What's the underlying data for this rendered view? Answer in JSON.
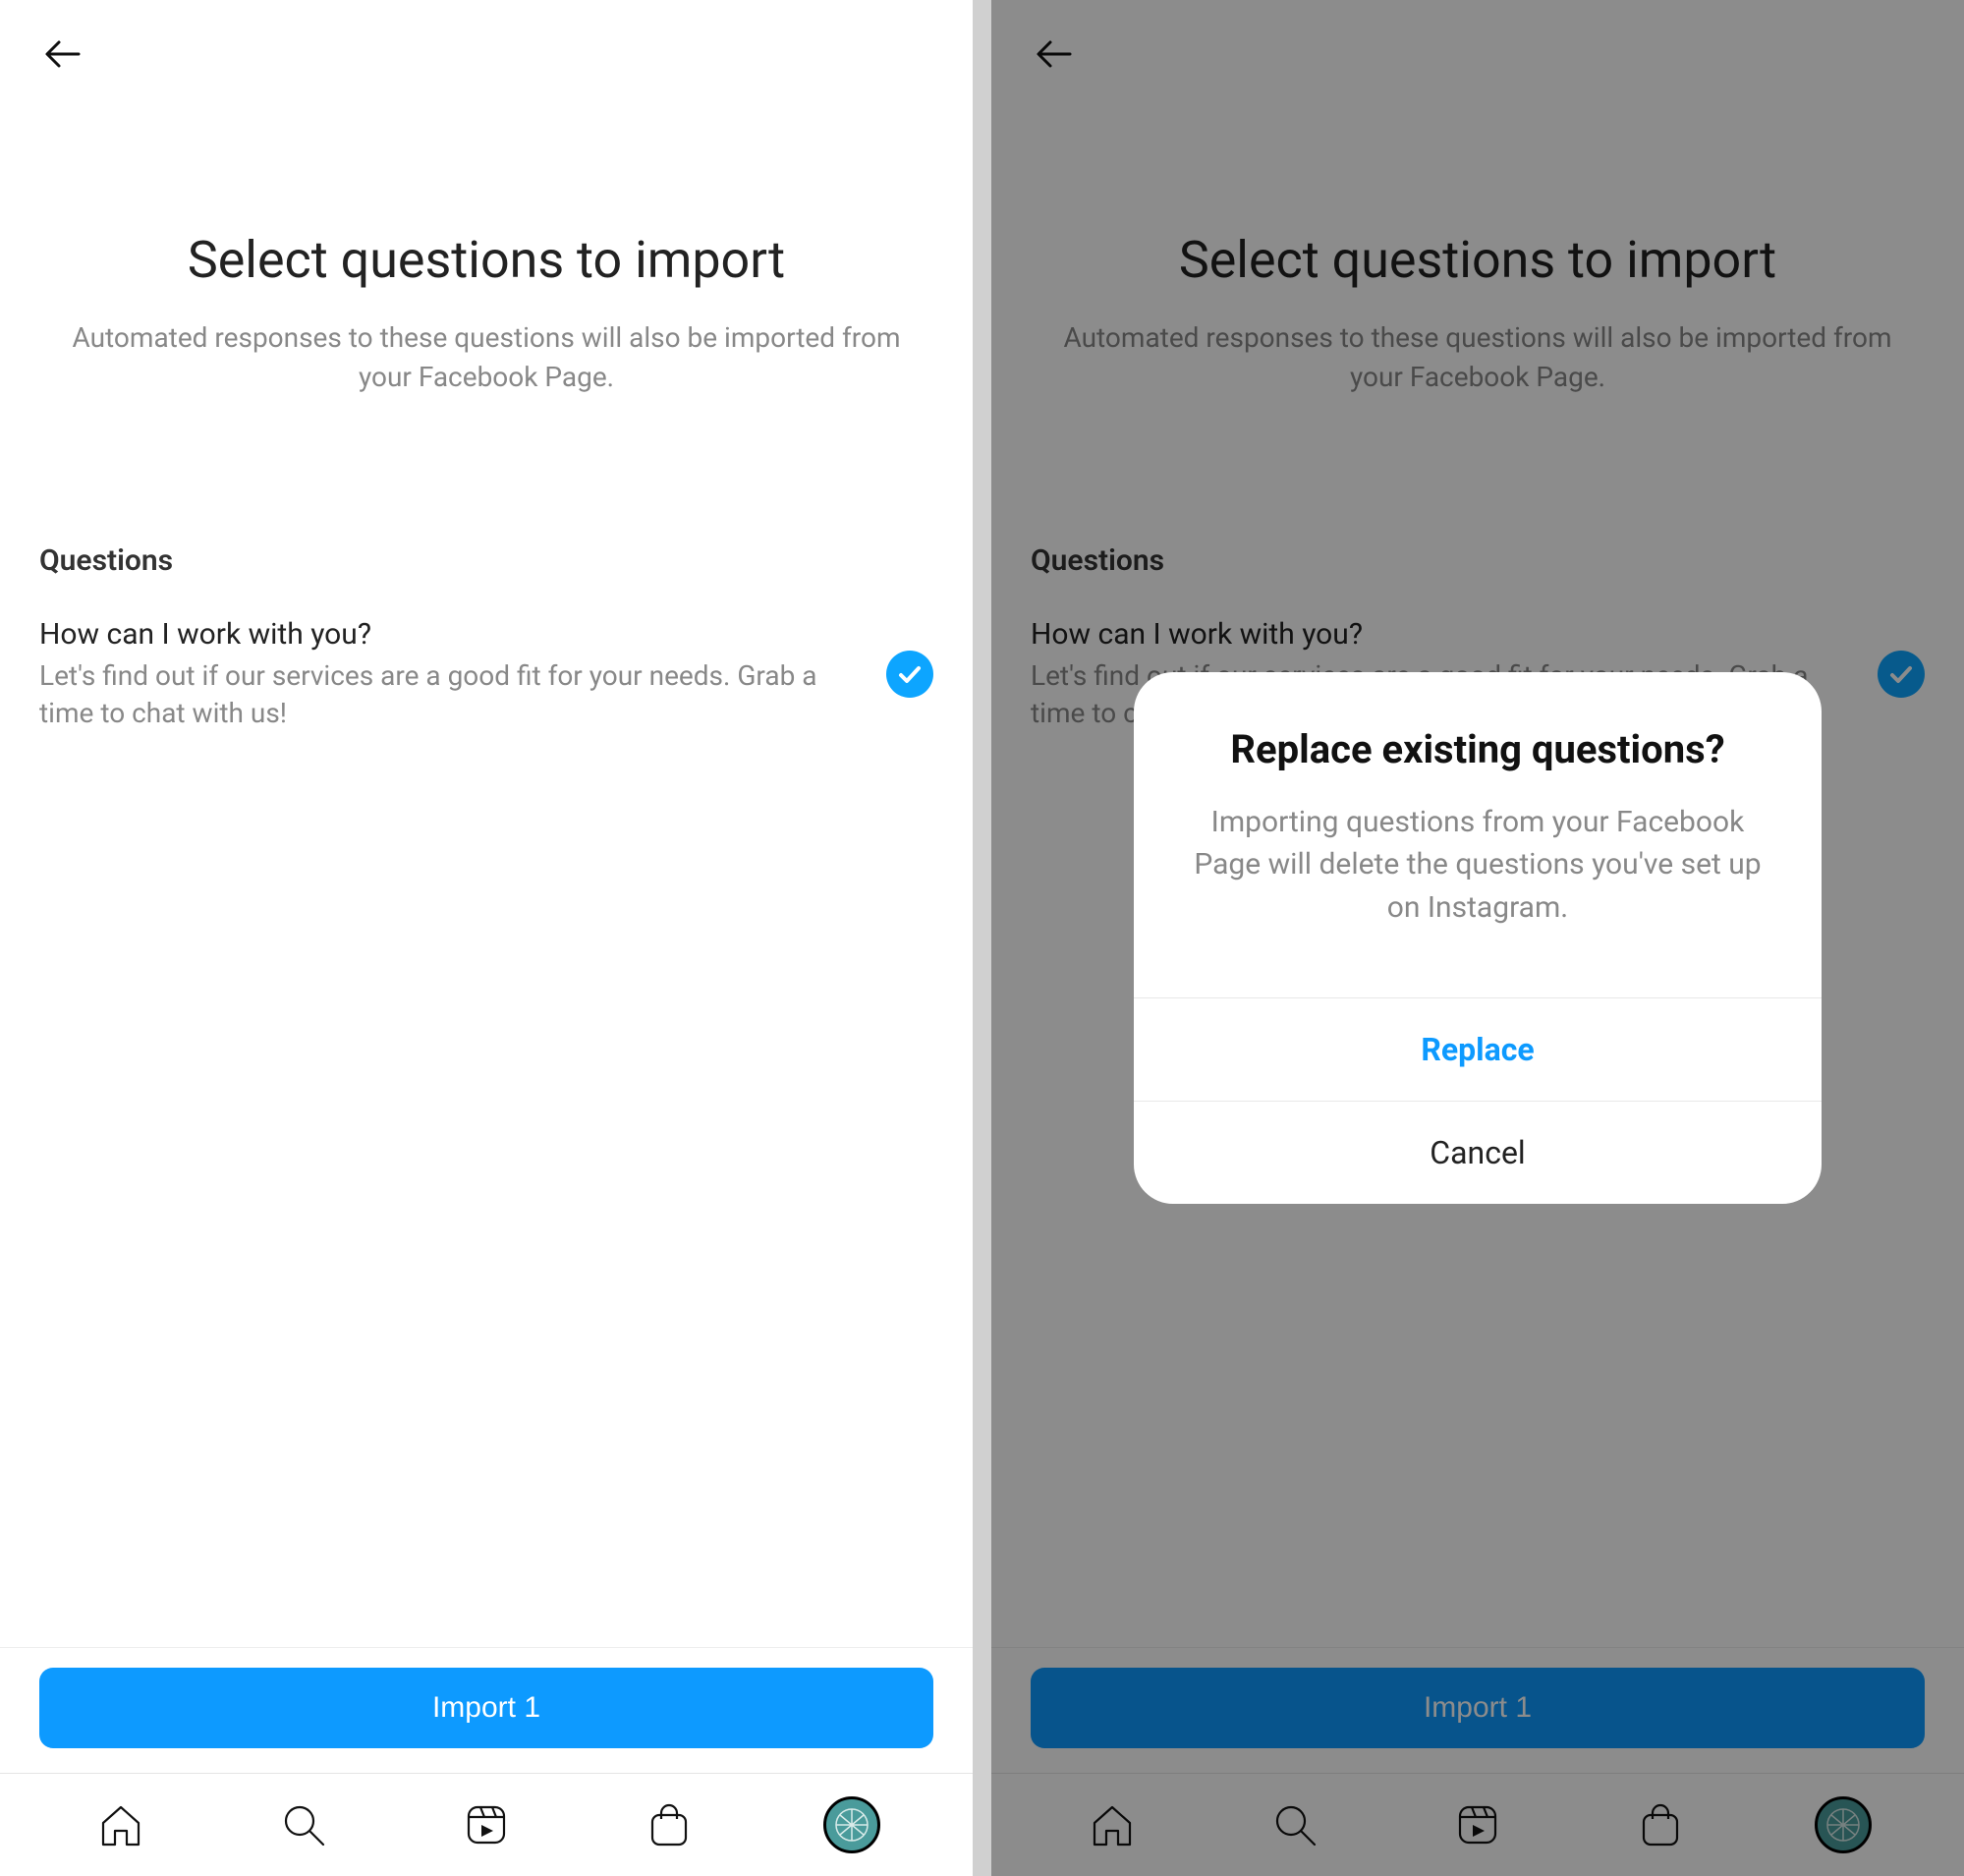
{
  "screen": {
    "title": "Select questions to import",
    "subtitle": "Automated responses to these questions will also be imported from your Facebook Page.",
    "section_heading": "Questions",
    "question": {
      "title": "How can I work with you?",
      "description": "Let's find out if our services are a good fit for your needs. Grab a time to chat with us!",
      "selected": true
    },
    "import_button": "Import 1"
  },
  "dialog": {
    "title": "Replace existing questions?",
    "message": "Importing questions from your Facebook Page will delete the questions you've set up on Instagram.",
    "primary": "Replace",
    "secondary": "Cancel"
  },
  "nav": {
    "home": "home-icon",
    "search": "search-icon",
    "reels": "reels-icon",
    "shop": "shop-icon",
    "profile": "profile-avatar"
  }
}
